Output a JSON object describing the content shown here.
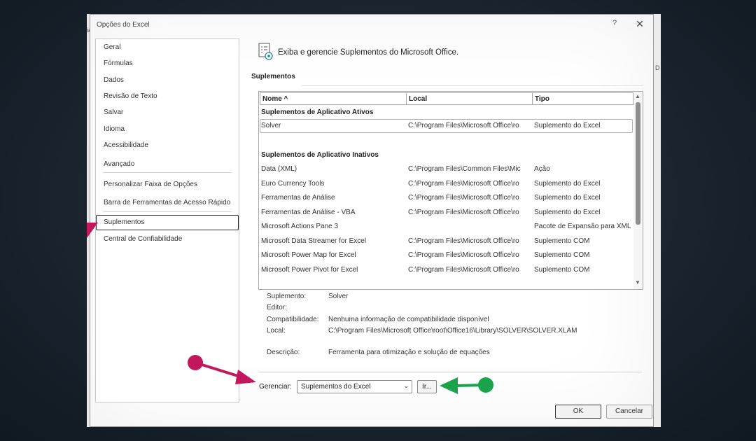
{
  "background": {
    "left_glyph": "ia",
    "right_glyph": "D"
  },
  "dialog": {
    "title": "Opções do Excel",
    "help_glyph": "?",
    "close_glyph": "✕"
  },
  "nav": {
    "items": [
      {
        "label": "Geral"
      },
      {
        "label": "Fórmulas"
      },
      {
        "label": "Dados"
      },
      {
        "label": "Revisão de Texto"
      },
      {
        "label": "Salvar"
      },
      {
        "label": "Idioma"
      },
      {
        "label": "Acessibilidade"
      },
      {
        "label": "Avançado"
      },
      {
        "label": "Personalizar Faixa de Opções"
      },
      {
        "label": "Barra de Ferramentas de Acesso Rápido"
      },
      {
        "label": "Suplementos",
        "selected": true
      },
      {
        "label": "Central de Confiabilidade"
      }
    ]
  },
  "main": {
    "header": "Exiba e gerencie Suplementos do Microsoft Office.",
    "section": "Suplementos",
    "columns": [
      "Nome ^",
      "Local",
      "Tipo"
    ],
    "active_group": "Suplementos de Aplicativo Ativos",
    "active_rows": [
      [
        "Solver",
        "C:\\Program Files\\Microsoft Office\\ro",
        "Suplemento do Excel"
      ]
    ],
    "inactive_group": "Suplementos de Aplicativo Inativos",
    "inactive_rows": [
      [
        "Data (XML)",
        "C:\\Program Files\\Common Files\\Mic",
        "Ação"
      ],
      [
        "Euro Currency Tools",
        "C:\\Program Files\\Microsoft Office\\ro",
        "Suplemento do Excel"
      ],
      [
        "Ferramentas de Análise",
        "C:\\Program Files\\Microsoft Office\\ro",
        "Suplemento do Excel"
      ],
      [
        "Ferramentas de Análise - VBA",
        "C:\\Program Files\\Microsoft Office\\ro",
        "Suplemento do Excel"
      ],
      [
        "Microsoft Actions Pane 3",
        "",
        "Pacote de Expansão para XML"
      ],
      [
        "Microsoft Data Streamer for Excel",
        "C:\\Program Files\\Microsoft Office\\ro",
        "Suplemento COM"
      ],
      [
        "Microsoft Power Map for Excel",
        "C:\\Program Files\\Microsoft Office\\ro",
        "Suplemento COM"
      ],
      [
        "Microsoft Power Pivot for Excel",
        "C:\\Program Files\\Microsoft Office\\ro",
        "Suplemento COM"
      ]
    ],
    "details": {
      "addin_label": "Suplemento:",
      "addin_value": "Solver",
      "editor_label": "Editor:",
      "editor_value": "",
      "compat_label": "Compatibilidade:",
      "compat_value": "Nenhuma informação de compatibilidade disponível",
      "location_label": "Local:",
      "location_value": "C:\\Program Files\\Microsoft Office\\root\\Office16\\Library\\SOLVER\\SOLVER.XLAM",
      "desc_label": "Descrição:",
      "desc_value": "Ferramenta para otimização e solução de equações"
    }
  },
  "footer": {
    "manage_label": "Gerenciar:",
    "manage_selected": "Suplementos do Excel",
    "go_label": "Ir...",
    "ok_label": "OK",
    "cancel_label": "Cancelar"
  },
  "annotations": {
    "magenta": "#c2185b",
    "green": "#1aa34a"
  }
}
